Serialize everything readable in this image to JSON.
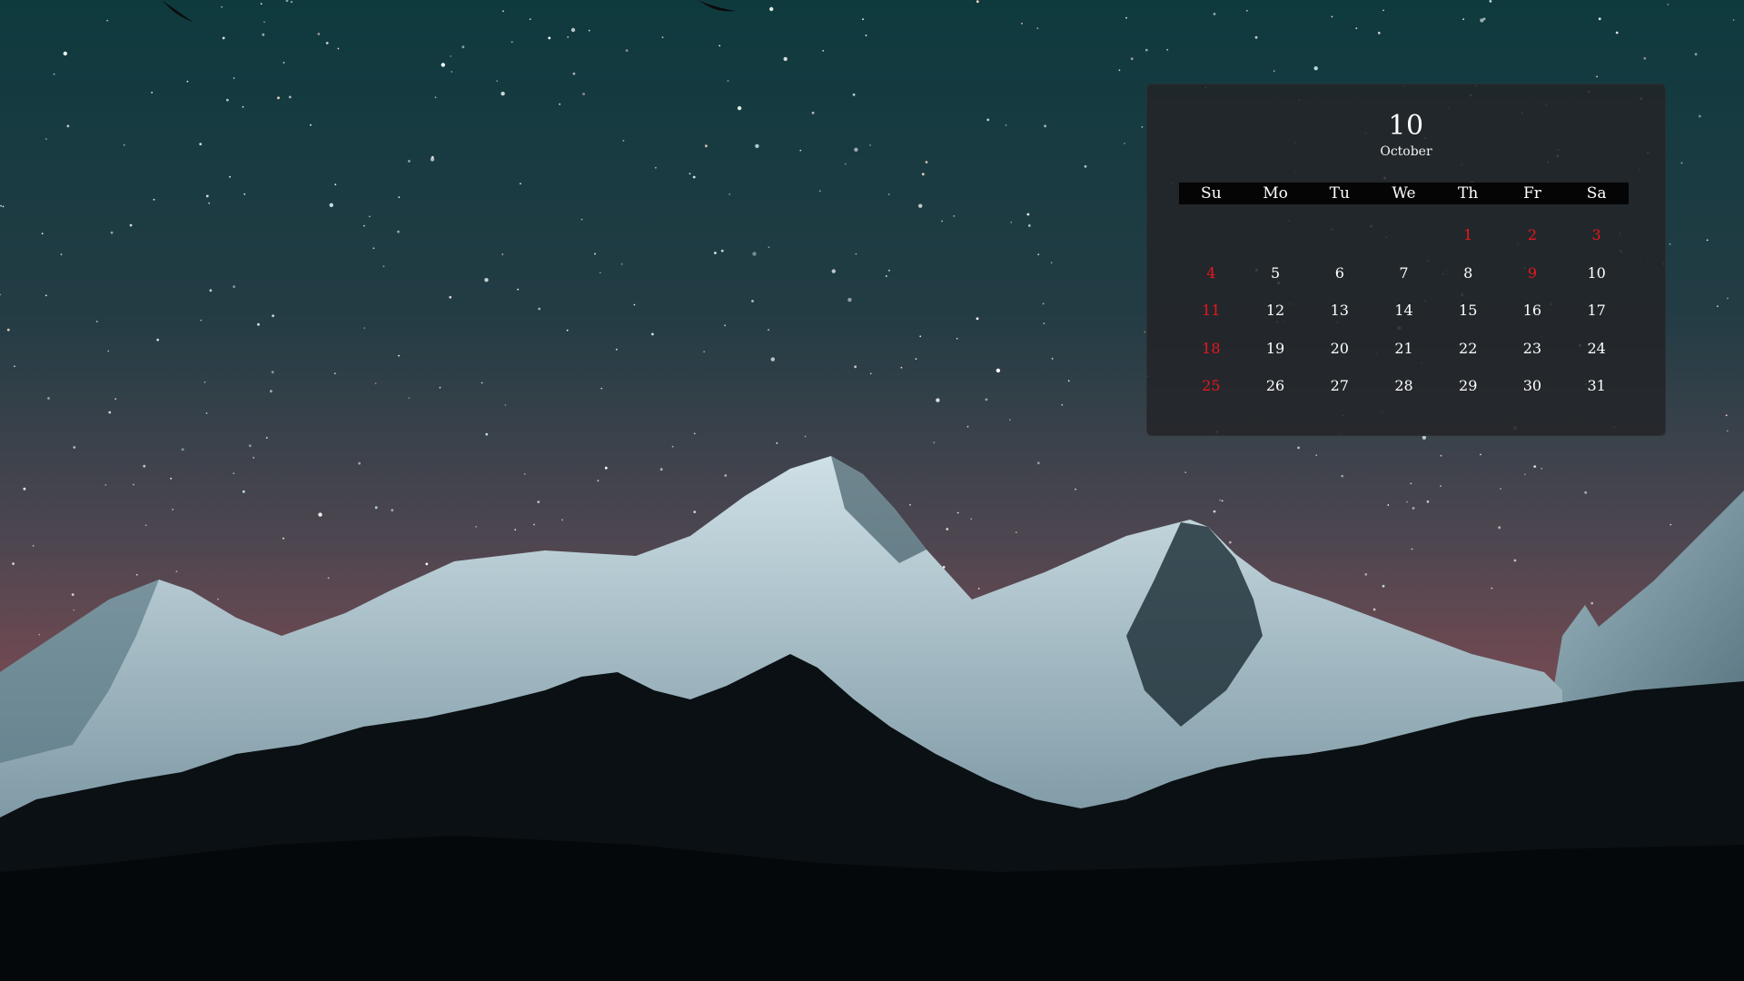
{
  "calendar": {
    "day_number": "10",
    "month_name": "October",
    "weekdays": [
      "Su",
      "Mo",
      "Tu",
      "We",
      "Th",
      "Fr",
      "Sa"
    ],
    "weeks": [
      [
        "",
        "",
        "",
        "",
        "1",
        "2",
        "3"
      ],
      [
        "4",
        "5",
        "6",
        "7",
        "8",
        "9",
        "10"
      ],
      [
        "11",
        "12",
        "13",
        "14",
        "15",
        "16",
        "17"
      ],
      [
        "18",
        "19",
        "20",
        "21",
        "22",
        "23",
        "24"
      ],
      [
        "25",
        "26",
        "27",
        "28",
        "29",
        "30",
        "31"
      ]
    ],
    "holiday_dates": [
      "1",
      "2",
      "3",
      "4",
      "9",
      "11",
      "18",
      "25"
    ],
    "colors": {
      "panel": "#232428",
      "text": "#ffffff",
      "holiday": "#e8171d",
      "weekday_bar": "#050506"
    }
  },
  "wallpaper": {
    "scene": "starry-night-snowy-mountains",
    "colors": {
      "sky_top": "#0f3a3e",
      "sky_horizon": "#6e4a52",
      "snow": "#b9ced6",
      "forest": "#0a0f12"
    }
  }
}
